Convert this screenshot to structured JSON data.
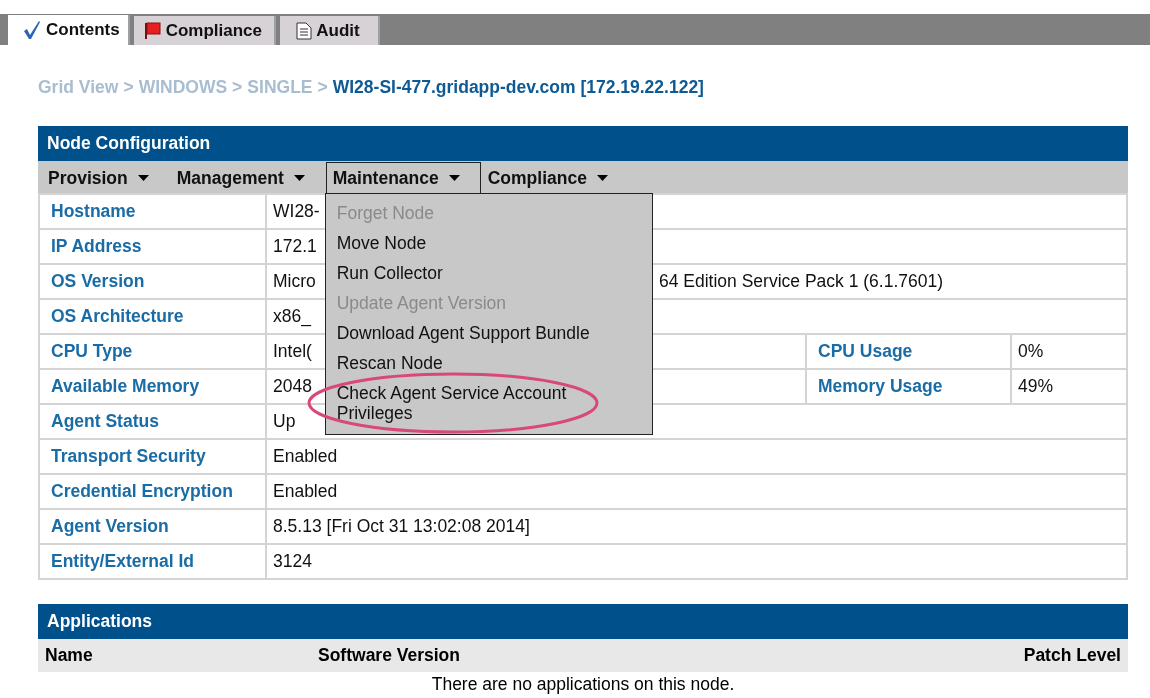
{
  "tabs": [
    {
      "label": "Contents",
      "selected": true
    },
    {
      "label": "Compliance",
      "selected": false
    },
    {
      "label": "Audit",
      "selected": false
    }
  ],
  "breadcrumb": [
    {
      "label": "Grid View",
      "kind": "link"
    },
    {
      "label": ">",
      "kind": "separator"
    },
    {
      "label": "WINDOWS",
      "kind": "link"
    },
    {
      "label": ">",
      "kind": "separator"
    },
    {
      "label": "SINGLE",
      "kind": "link"
    },
    {
      "label": ">",
      "kind": "separator"
    },
    {
      "label": "WI28-SI-477.gridapp-dev.com [172.19.22.122]",
      "kind": "current"
    }
  ],
  "node_configuration": {
    "title": "Node Configuration",
    "menu_bar": [
      {
        "label": "Provision",
        "expanded": false
      },
      {
        "label": "Management",
        "expanded": false
      },
      {
        "label": "Maintenance",
        "expanded": true,
        "items": [
          {
            "label": "Forget Node",
            "disabled": true,
            "circled": false
          },
          {
            "label": "Move Node",
            "disabled": false,
            "circled": false
          },
          {
            "label": "Run Collector",
            "disabled": false,
            "circled": false
          },
          {
            "label": "Update Agent Version",
            "disabled": true,
            "circled": false
          },
          {
            "label": "Download Agent Support Bundle",
            "disabled": false,
            "circled": false
          },
          {
            "label": "Rescan Node",
            "disabled": false,
            "circled": false
          },
          {
            "label": "Check Agent Service Account Privileges",
            "disabled": false,
            "circled": true
          }
        ]
      },
      {
        "label": "Compliance",
        "expanded": false
      }
    ],
    "rows": [
      {
        "label": "Hostname",
        "value": "WI28-"
      },
      {
        "label": "IP Address",
        "value": "172.1"
      },
      {
        "label": "OS Version",
        "value": "Micro",
        "value_tail": "64 Edition Service Pack 1 (6.1.7601)"
      },
      {
        "label": "OS Architecture",
        "value": "x86_"
      },
      {
        "label": "CPU Type",
        "value": "Intel(",
        "label_2": "CPU Usage",
        "value_2": "0%"
      },
      {
        "label": "Available Memory",
        "value": "2048",
        "label_2": "Memory Usage",
        "value_2": "49%"
      },
      {
        "label": "Agent Status",
        "value": "Up"
      },
      {
        "label": "Transport Security",
        "value": "Enabled"
      },
      {
        "label": "Credential Encryption",
        "value": "Enabled"
      },
      {
        "label": "Agent Version",
        "value": "8.5.13 [Fri Oct 31 13:02:08 2014]"
      },
      {
        "label": "Entity/External Id",
        "value": "3124"
      }
    ]
  },
  "applications": {
    "title": "Applications",
    "columns": [
      "Name",
      "Software Version",
      "Patch Level"
    ],
    "empty_message": "There are no applications on this node."
  }
}
